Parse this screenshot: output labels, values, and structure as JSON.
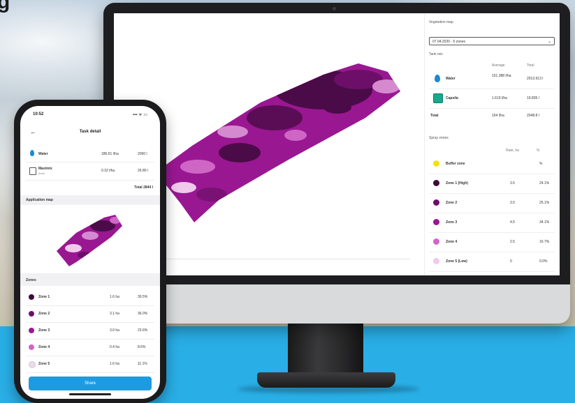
{
  "brand_fragment": "g",
  "desktop": {
    "vegetation_map": {
      "label": "Vegetation map",
      "selected": "07.04.2020 - 5 zones"
    },
    "tank_mix": {
      "label": "Tank mix",
      "col_average": "Average",
      "col_total": "Total",
      "rows": [
        {
          "name": "Water",
          "average": "151.388 l/ha",
          "total": "2013.913 l"
        },
        {
          "name": "Capsila",
          "average": "1.619 l/ha",
          "total": "19.835 l"
        }
      ],
      "total_label": "Total",
      "total_average": "154 l/ha",
      "total_total": "2048.8 l"
    },
    "spray_zones": {
      "label": "Spray zones",
      "col_rate": "Rate, ha",
      "col_pct": "%",
      "rows": [
        {
          "name": "Buffer zone",
          "rate": "",
          "pct": "%",
          "color": "#f4e017"
        },
        {
          "name": "Zone 1 (High)",
          "rate": "3.5",
          "pct": "24.1%",
          "color": "#3d0a3a"
        },
        {
          "name": "Zone 2",
          "rate": "3.5",
          "pct": "25.1%",
          "color": "#6d0f68"
        },
        {
          "name": "Zone 3",
          "rate": "4.5",
          "pct": "34.1%",
          "color": "#9a1792"
        },
        {
          "name": "Zone 4",
          "rate": "2.5",
          "pct": "16.7%",
          "color": "#cf66c6"
        },
        {
          "name": "Zone 5 (Low)",
          "rate": "0",
          "pct": "0.0%",
          "color": "#f0c9ec"
        }
      ]
    }
  },
  "phone": {
    "time": "10:52",
    "status_icons": "▪▪▪ ᯤ ▭",
    "title": "Task detail",
    "products": [
      {
        "name": "Water",
        "sub": "",
        "rate": "186.61 l/ha",
        "amount": "2090 l"
      },
      {
        "name": "Maximix",
        "sub": "Amol",
        "rate": "0.32 l/ha",
        "amount": "26.80 l"
      }
    ],
    "total": "Total 2844 l",
    "application_map_label": "Application map",
    "zones_label": "Zones",
    "zones": [
      {
        "name": "Zone 1",
        "rate": "1.6 ha",
        "pct": "30.5%",
        "color": "#3d0a3a"
      },
      {
        "name": "Zone 2",
        "rate": "3.1 ha",
        "pct": "36.0%",
        "color": "#6d0f68"
      },
      {
        "name": "Zone 3",
        "rate": "3.0 ha",
        "pct": "23.6%",
        "color": "#9a1792"
      },
      {
        "name": "Zone 4",
        "rate": "0.4 ha",
        "pct": "8.6%",
        "color": "#cf66c6"
      },
      {
        "name": "Zone 5",
        "rate": "1.6 ha",
        "pct": "11.1%",
        "color": "#f0d8ee"
      }
    ],
    "button_label": "Share"
  }
}
